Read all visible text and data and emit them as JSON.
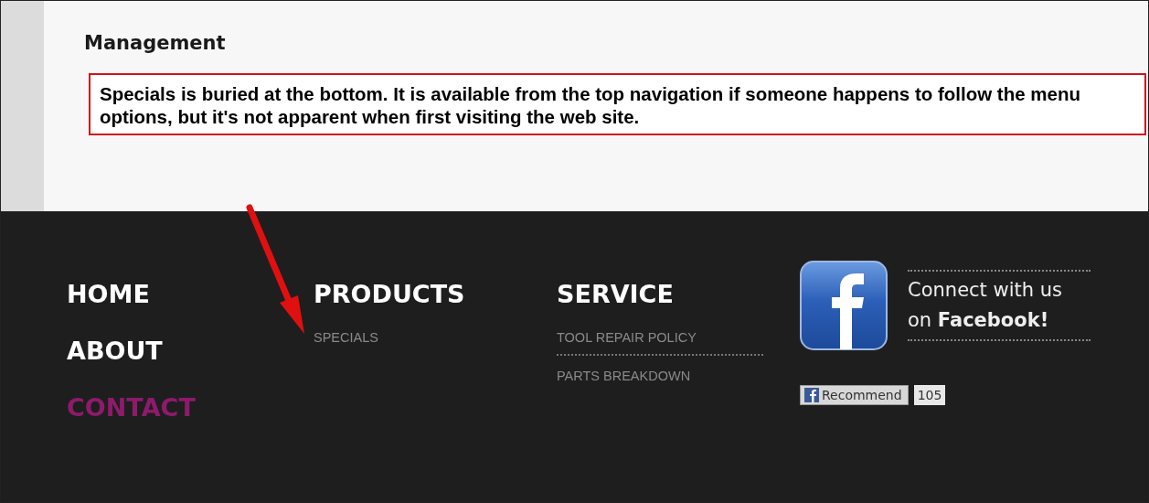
{
  "section": {
    "title": "Management"
  },
  "annotation": {
    "note": "Specials is buried at the bottom. It is available from the top navigation if  someone happens to follow the menu options, but it's not apparent when first visiting the web site."
  },
  "footer": {
    "nav": [
      {
        "label": "HOME",
        "selected": false
      },
      {
        "label": "ABOUT",
        "selected": false
      },
      {
        "label": "CONTACT",
        "selected": true
      }
    ],
    "columns": [
      {
        "heading": "PRODUCTS",
        "links": [
          "SPECIALS"
        ]
      },
      {
        "heading": "SERVICE",
        "links": [
          "TOOL REPAIR POLICY",
          "PARTS BREAKDOWN"
        ]
      }
    ],
    "social": {
      "text": "Connect with us on **Facebook!**",
      "button": "Recommend",
      "count": "105"
    }
  }
}
